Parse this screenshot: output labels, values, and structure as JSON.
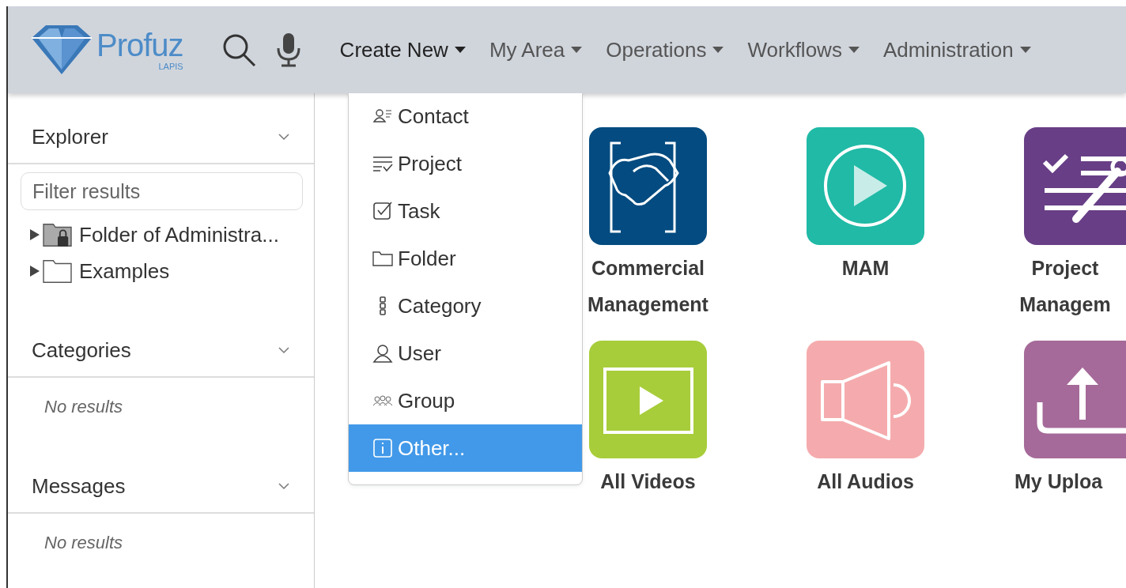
{
  "logo": {
    "name": "Profuz",
    "sub": "LAPIS"
  },
  "menu": [
    {
      "label": "Create New",
      "expanded": true
    },
    {
      "label": "My Area",
      "expanded": false
    },
    {
      "label": "Operations",
      "expanded": false
    },
    {
      "label": "Workflows",
      "expanded": false
    },
    {
      "label": "Administration",
      "expanded": false
    }
  ],
  "dropdown": [
    {
      "label": "Contact",
      "selected": false
    },
    {
      "label": "Project",
      "selected": false
    },
    {
      "label": "Task",
      "selected": false
    },
    {
      "label": "Folder",
      "selected": false
    },
    {
      "label": "Category",
      "selected": false
    },
    {
      "label": "User",
      "selected": false
    },
    {
      "label": "Group",
      "selected": false
    },
    {
      "label": "Other...",
      "selected": true
    }
  ],
  "sidebar": [
    {
      "title": "Explorer",
      "kind": "tree",
      "placeholder": "Filter results",
      "items": [
        {
          "label": "Folder of Administra...",
          "locked": true
        },
        {
          "label": "Examples",
          "locked": false
        }
      ]
    },
    {
      "title": "Categories",
      "kind": "empty",
      "message": "No results"
    },
    {
      "title": "Messages",
      "kind": "empty",
      "message": "No results"
    }
  ],
  "tile_rows": [
    [
      {
        "label": "Commercial Management",
        "color": "#034b80"
      },
      {
        "label": "MAM",
        "color": "#20baa6"
      },
      {
        "label": "Project Managem",
        "color": "#683f86"
      }
    ],
    [
      {
        "label": "All Videos",
        "color": "#a7cd3a"
      },
      {
        "label": "All Audios",
        "color": "#f5abad"
      },
      {
        "label": "My Uploa",
        "color": "#a56a99"
      }
    ]
  ]
}
